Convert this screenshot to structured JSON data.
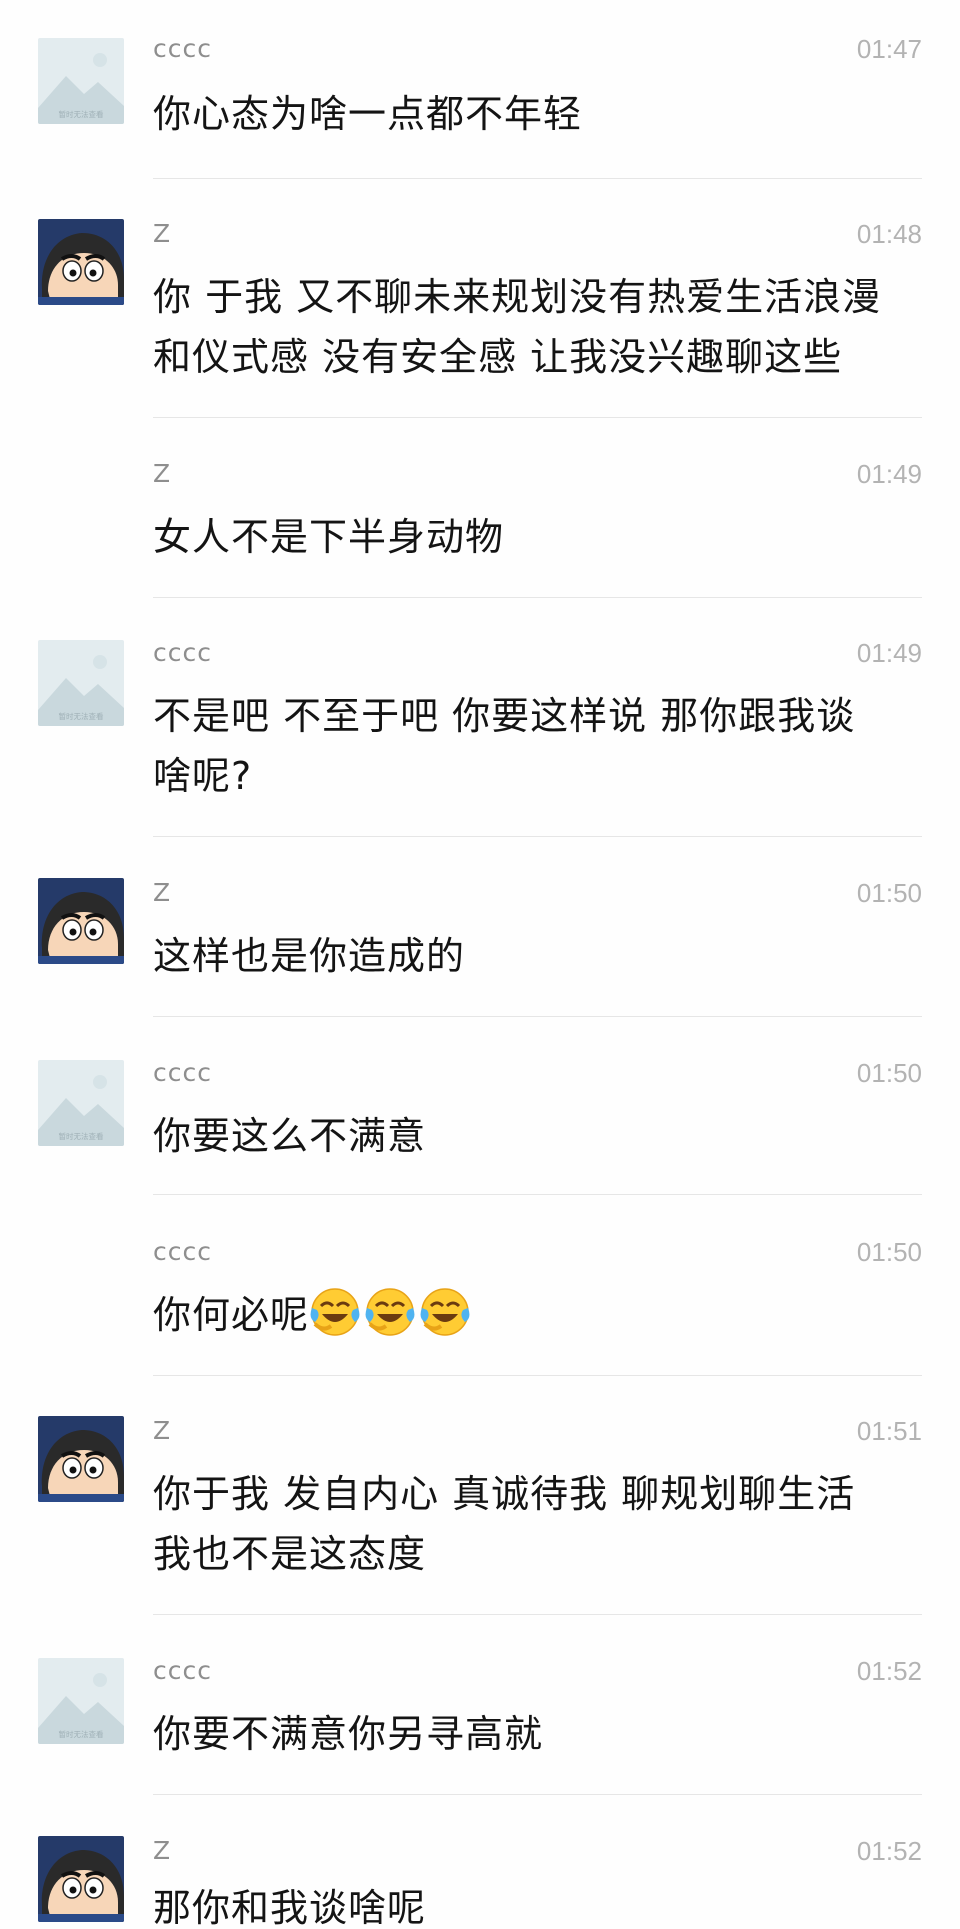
{
  "messages": [
    {
      "sender": "cccc",
      "time": "01:47",
      "text": "你心态为啥一点都不年轻",
      "avatar": "placeholder-image-icon",
      "avatar_caption": "暂时无法查看"
    },
    {
      "sender": "Z",
      "time": "01:48",
      "text": "你 于我 又不聊未来规划没有热爱生活浪漫\n和仪式感 没有安全感 让我没兴趣聊这些",
      "avatar": "cartoon-boy-avatar"
    },
    {
      "sender": "Z",
      "time": "01:49",
      "text": "女人不是下半身动物"
    },
    {
      "sender": "cccc",
      "time": "01:49",
      "text": "不是吧 不至于吧 你要这样说 那你跟我谈\n啥呢?",
      "avatar": "placeholder-image-icon",
      "avatar_caption": "暂时无法查看"
    },
    {
      "sender": "Z",
      "time": "01:50",
      "text": "这样也是你造成的",
      "avatar": "cartoon-boy-avatar"
    },
    {
      "sender": "cccc",
      "time": "01:50",
      "text": "你要这么不满意",
      "avatar": "placeholder-image-icon",
      "avatar_caption": "暂时无法查看"
    },
    {
      "sender": "cccc",
      "time": "01:50",
      "text": "你何必呢",
      "emoji": [
        "laugh-cry-emoji",
        "laugh-cry-emoji",
        "laugh-cry-emoji"
      ]
    },
    {
      "sender": "Z",
      "time": "01:51",
      "text": "你于我 发自内心 真诚待我 聊规划聊生活\n我也不是这态度",
      "avatar": "cartoon-boy-avatar"
    },
    {
      "sender": "cccc",
      "time": "01:52",
      "text": "你要不满意你另寻高就",
      "avatar": "placeholder-image-icon",
      "avatar_caption": "暂时无法查看"
    },
    {
      "sender": "Z",
      "time": "01:52",
      "text": "那你和我谈啥呢",
      "avatar": "cartoon-boy-avatar"
    }
  ],
  "colors": {
    "background": "#fefefe",
    "sender": "#8e8e8e",
    "time": "#b3b3b3",
    "text": "#141414",
    "divider": "#e6e6e6"
  }
}
